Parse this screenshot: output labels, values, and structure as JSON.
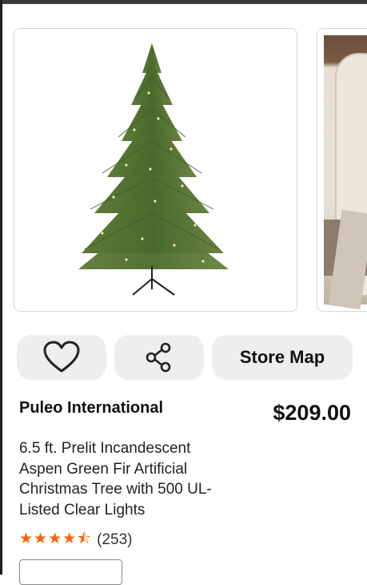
{
  "product": {
    "brand": "Puleo International",
    "price": "$209.00",
    "title": "6.5 ft. Prelit Incandescent Aspen Green Fir Artificial Christmas Tree with 500 UL-Listed Clear Lights",
    "rating": {
      "stars": 4.5,
      "stars_display": "★★★★",
      "review_count": "(253)"
    }
  },
  "actions": {
    "favorite_icon": "heart-icon",
    "share_icon": "share-icon",
    "store_map_label": "Store Map"
  },
  "colors": {
    "accent": "#f96302",
    "pill_bg": "#eeeeee",
    "tree_green": "#4f6b2f"
  }
}
